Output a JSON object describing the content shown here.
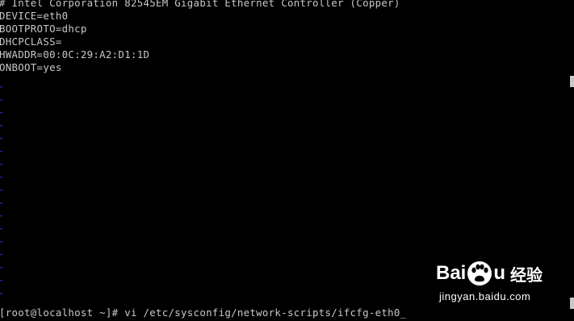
{
  "terminal": {
    "file_lines": [
      "# Intel Corporation 82545EM Gigabit Ethernet Controller (Copper)",
      "DEVICE=eth0",
      "BOOTPROTO=dhcp",
      "DHCPCLASS=",
      "HWADDR=00:0C:29:A2:D1:1D",
      "ONBOOT=yes"
    ],
    "empty_line_marker": "~",
    "prompt_line": "[root@localhost ~]# vi /etc/sysconfig/network-scripts/ifcfg-eth0",
    "cursor": "_"
  },
  "watermark": {
    "logo_left": "Bai",
    "logo_right": "u",
    "logo_cn": "经验",
    "url": "jingyan.baidu.com"
  },
  "colors": {
    "background": "#000000",
    "text": "#c8c8c8",
    "tilde": "#2c2cb8"
  }
}
